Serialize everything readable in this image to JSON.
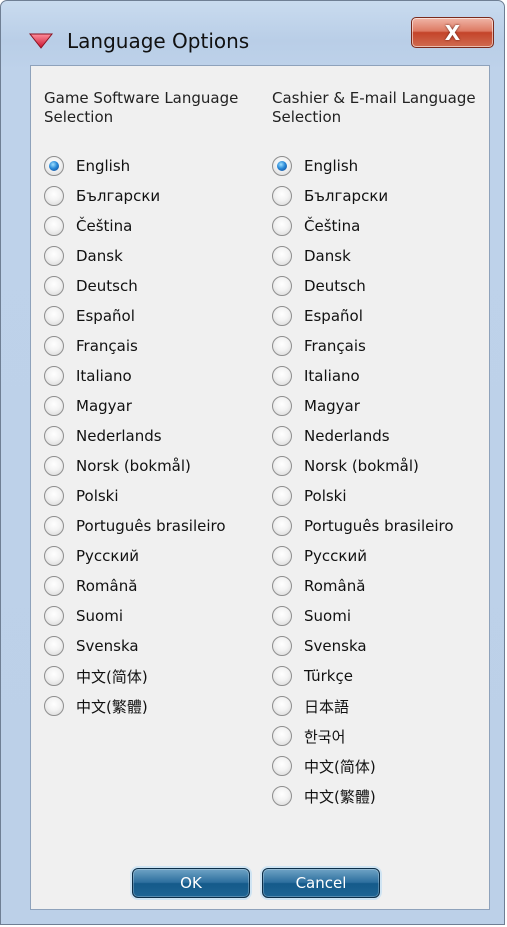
{
  "window": {
    "title": "Language Options",
    "close_label": "X"
  },
  "left_column": {
    "header": "Game Software Language Selection",
    "options": [
      {
        "label": "English",
        "selected": true
      },
      {
        "label": "Български",
        "selected": false
      },
      {
        "label": "Čeština",
        "selected": false
      },
      {
        "label": "Dansk",
        "selected": false
      },
      {
        "label": "Deutsch",
        "selected": false
      },
      {
        "label": "Español",
        "selected": false
      },
      {
        "label": "Français",
        "selected": false
      },
      {
        "label": "Italiano",
        "selected": false
      },
      {
        "label": "Magyar",
        "selected": false
      },
      {
        "label": "Nederlands",
        "selected": false
      },
      {
        "label": "Norsk (bokmål)",
        "selected": false
      },
      {
        "label": "Polski",
        "selected": false
      },
      {
        "label": "Português brasileiro",
        "selected": false
      },
      {
        "label": "Русский",
        "selected": false
      },
      {
        "label": "Română",
        "selected": false
      },
      {
        "label": "Suomi",
        "selected": false
      },
      {
        "label": "Svenska",
        "selected": false
      },
      {
        "label": "中文(简体)",
        "selected": false
      },
      {
        "label": "中文(繁體)",
        "selected": false
      }
    ]
  },
  "right_column": {
    "header": "Cashier & E-mail Language Selection",
    "options": [
      {
        "label": "English",
        "selected": true
      },
      {
        "label": "Български",
        "selected": false
      },
      {
        "label": "Čeština",
        "selected": false
      },
      {
        "label": "Dansk",
        "selected": false
      },
      {
        "label": "Deutsch",
        "selected": false
      },
      {
        "label": "Español",
        "selected": false
      },
      {
        "label": "Français",
        "selected": false
      },
      {
        "label": "Italiano",
        "selected": false
      },
      {
        "label": "Magyar",
        "selected": false
      },
      {
        "label": "Nederlands",
        "selected": false
      },
      {
        "label": "Norsk (bokmål)",
        "selected": false
      },
      {
        "label": "Polski",
        "selected": false
      },
      {
        "label": "Português brasileiro",
        "selected": false
      },
      {
        "label": "Русский",
        "selected": false
      },
      {
        "label": "Română",
        "selected": false
      },
      {
        "label": "Suomi",
        "selected": false
      },
      {
        "label": "Svenska",
        "selected": false
      },
      {
        "label": "Türkçe",
        "selected": false
      },
      {
        "label": "日本語",
        "selected": false
      },
      {
        "label": "한국어",
        "selected": false
      },
      {
        "label": "中文(简体)",
        "selected": false
      },
      {
        "label": "中文(繁體)",
        "selected": false
      }
    ]
  },
  "buttons": {
    "ok_label": "OK",
    "cancel_label": "Cancel"
  },
  "icons": {
    "title_icon": "chevron-down-icon"
  },
  "colors": {
    "title_icon": "#e8384f",
    "close_button": "#c4442a",
    "dialog_button": "#1f6594",
    "selected_radio": "#2a8ad8"
  }
}
